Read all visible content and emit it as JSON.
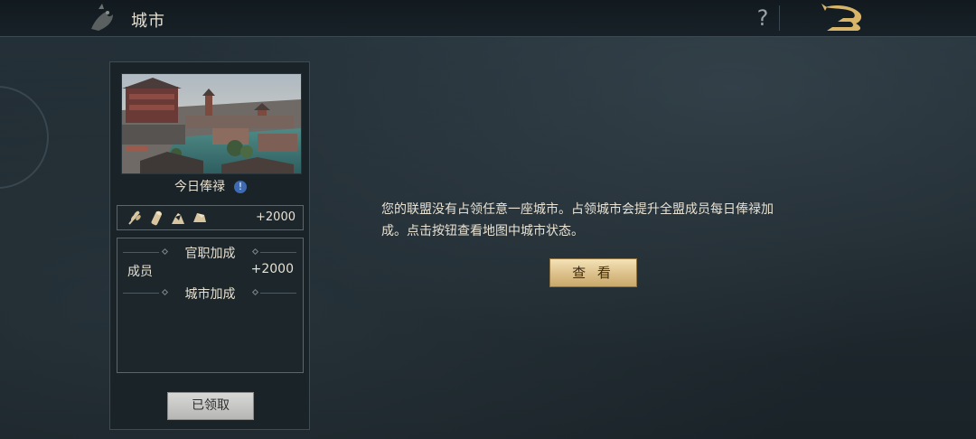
{
  "header": {
    "title": "城市",
    "help_icon": "?",
    "back_icon": "dragon-back-icon"
  },
  "card": {
    "image": "city-scene-image",
    "salary_label": "今日俸禄",
    "info_icon": "!",
    "resources": {
      "icons": [
        "wheat-icon",
        "wood-icon",
        "stone-icon",
        "iron-icon"
      ],
      "value": "+2000"
    },
    "bonus": {
      "official_header": "官职加成",
      "member_label": "成员",
      "member_value": "+2000",
      "city_header": "城市加成"
    },
    "claimed_button": "已领取"
  },
  "main": {
    "message_line1": "您的联盟没有占领任意一座城市。占领城市会提升全盟成员每日俸禄加",
    "message_line2": "成。点击按钮查看地图中城市状态。",
    "view_button": "查 看"
  },
  "colors": {
    "gold_button": "#dcc08a",
    "claimed_button": "#c6c6c4",
    "info_blue": "#3d6ab0",
    "panel_border": "#5b676d"
  }
}
